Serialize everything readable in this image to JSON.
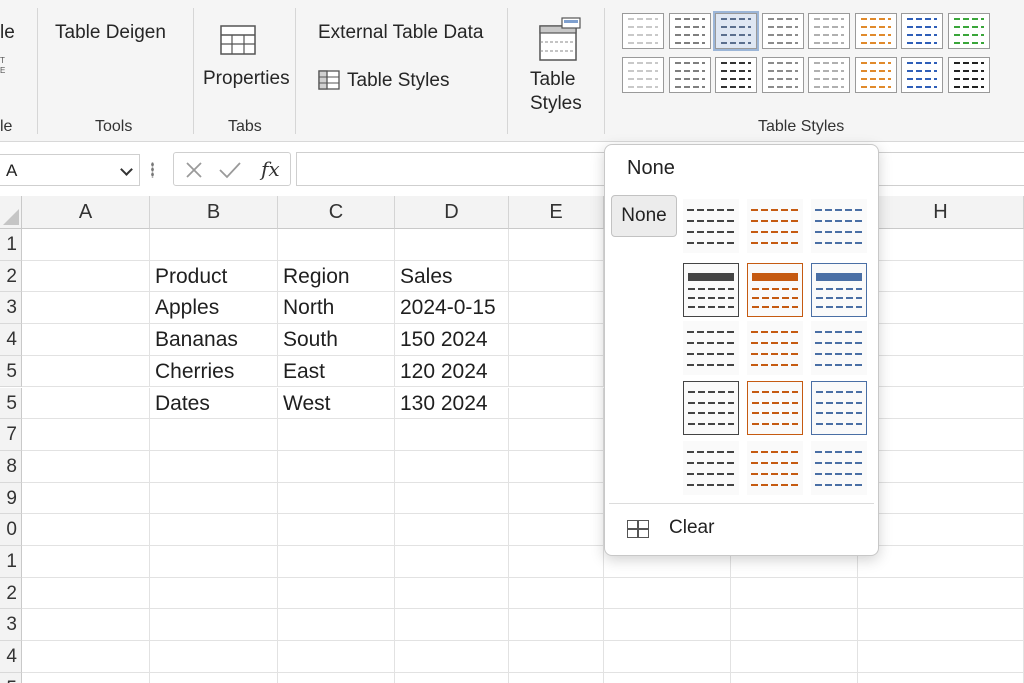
{
  "ribbon": {
    "partial_left_label": "le",
    "partial_left_group": "le",
    "table_design_label": "Table Deigen",
    "tools_group": "Tools",
    "properties_label": "Properties",
    "tabs_group": "Tabs",
    "external_table_data_label": "External Table Data",
    "table_styles_small_label": "Table Styles",
    "table_styles_big_line1": "Table",
    "table_styles_big_line2": "Styles",
    "table_styles_group": "Table Styles",
    "gallery_colors": [
      "#c9c9c9",
      "#7f7f7f",
      "#5b6f8e",
      "#8c8c8c",
      "#b0b0b0",
      "#e08a2c",
      "#2f5fb8",
      "#3aa63a",
      "#c9c9c9",
      "#7f7f7f",
      "#333333",
      "#8c8c8c",
      "#b0b0b0",
      "#e08a2c",
      "#2f5fb8",
      "#222222"
    ]
  },
  "formula_bar": {
    "name_box": "A",
    "cancel_icon": "x-icon",
    "enter_icon": "check-icon",
    "fx_label": "fx",
    "formula": ""
  },
  "columns": [
    "A",
    "B",
    "C",
    "D",
    "E",
    "",
    "",
    "H"
  ],
  "rows": [
    "1",
    "2",
    "3",
    "4",
    "5",
    "5",
    "7",
    "8",
    "9",
    "0",
    "1",
    "2",
    "3",
    "4",
    "5"
  ],
  "cells": {
    "r2": [
      "",
      "Product",
      "Region",
      "Sales"
    ],
    "r3": [
      "",
      "Apples",
      "North",
      "2024-0-15"
    ],
    "r4": [
      "",
      "Bananas",
      "South",
      "150    2024"
    ],
    "r5": [
      "",
      "Cherries",
      "East",
      "120    2024"
    ],
    "r6": [
      "",
      "Dates",
      "West",
      "130    2024"
    ]
  },
  "popup": {
    "title": "None",
    "none_button": "None",
    "clear_label": "Clear",
    "style_colors": [
      "#444444",
      "#c55a11",
      "#4a6fa5"
    ]
  }
}
